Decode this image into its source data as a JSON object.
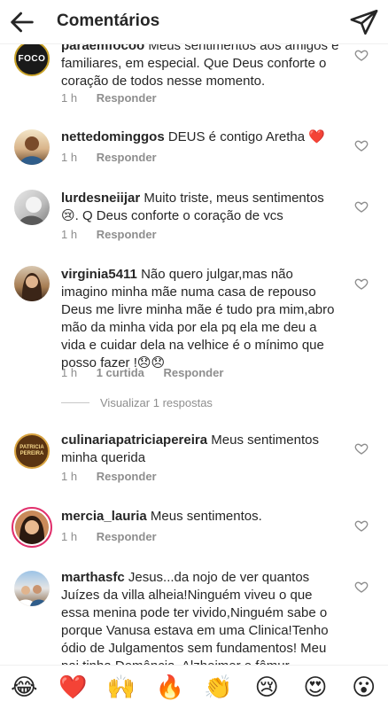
{
  "header": {
    "title": "Comentários"
  },
  "comments": [
    {
      "username": "paraemfocoo",
      "text": "Meus sentimentos aos amigos e familiares, em especial. Que Deus conforte o coração de todos nesse momento.",
      "time": "1 h",
      "likes": "",
      "reply": "Responder",
      "avatar_label": "FOCO"
    },
    {
      "username": "nettedominggos",
      "text": "DEUS é contigo Aretha ❤️",
      "time": "1 h",
      "likes": "",
      "reply": "Responder"
    },
    {
      "username": "lurdesneiijar",
      "text": "Muito triste, meus sentimentos 😢. Q Deus conforte o coração de vcs",
      "time": "1 h",
      "likes": "",
      "reply": "Responder"
    },
    {
      "username": "virginia5411",
      "text": "Não quero julgar,mas não imagino minha mãe numa casa de repouso Deus me livre minha mãe é tudo pra mim,abro mão da minha vida por ela pq ela me deu a vida e cuidar dela na velhice é o mínimo que posso fazer !😞😞",
      "time": "1 h",
      "likes": "1 curtida",
      "reply": "Responder"
    },
    {
      "username": "culinariapatriciapereira",
      "text": "Meus sentimentos minha querida",
      "time": "1 h",
      "likes": "",
      "reply": "Responder",
      "avatar_label": "PATRICIA PEREIRA"
    },
    {
      "username": "mercia_lauria",
      "text": "Meus sentimentos.",
      "time": "1 h",
      "likes": "",
      "reply": "Responder"
    },
    {
      "username": "marthasfc",
      "text": "Jesus...da nojo de ver quantos Juízes da villa alheia!Ninguém viveu o que essa menina pode ter vivido,Ninguém sabe o porque Vanusa estava em uma Clinica!Tenho ódio de Julgamentos sem fundamentos! Meu pai tinha Demência, Alzheimer e fêmur",
      "time": "",
      "likes": "",
      "reply": ""
    }
  ],
  "view_replies": "Visualizar 1 respostas",
  "emoji_bar": [
    "😂",
    "❤️",
    "🙌",
    "🔥",
    "👏",
    "😢",
    "😍",
    "😮"
  ],
  "icons": {
    "back": "arrow-left-icon",
    "send": "paper-plane-icon",
    "like": "heart-outline-icon"
  },
  "colors": {
    "text": "#262626",
    "secondary": "#8e8e8e",
    "heart_red": "#ed4956"
  }
}
